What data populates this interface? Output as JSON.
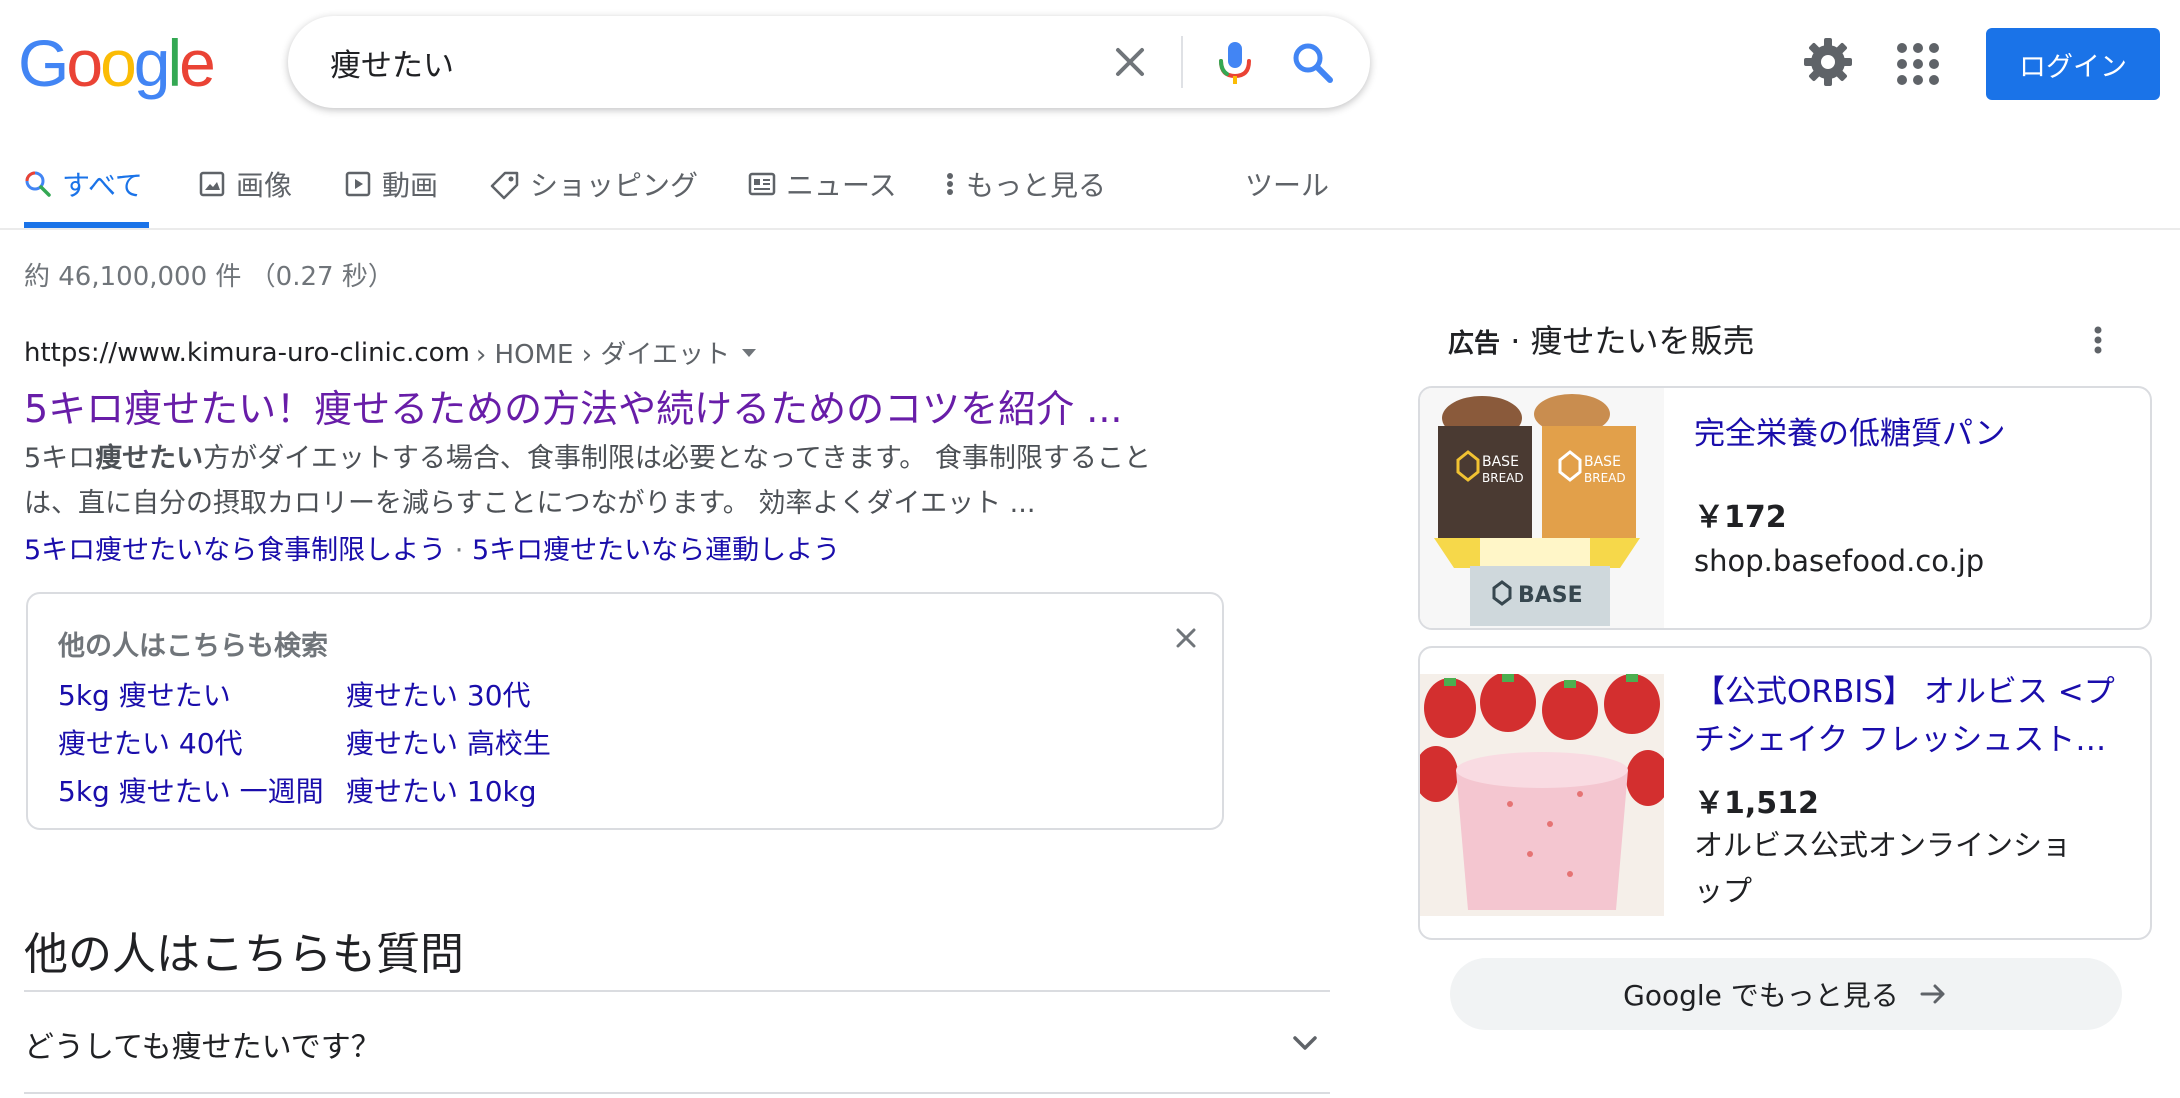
{
  "header": {
    "logo_letters": [
      "G",
      "o",
      "o",
      "g",
      "l",
      "e"
    ],
    "logo_colors": [
      "#4285F4",
      "#EA4335",
      "#FBBC05",
      "#4285F4",
      "#34A853",
      "#EA4335"
    ],
    "query": "痩せたい",
    "login_label": "ログイン"
  },
  "tabs": [
    {
      "label": "すべて",
      "icon": "search-icon",
      "active": true
    },
    {
      "label": "画像",
      "icon": "image-icon"
    },
    {
      "label": "動画",
      "icon": "play-icon"
    },
    {
      "label": "ショッピング",
      "icon": "tag-icon"
    },
    {
      "label": "ニュース",
      "icon": "news-icon"
    },
    {
      "label": "もっと見る",
      "icon": "more-vert-icon"
    },
    {
      "label": "ツール"
    }
  ],
  "stats": "約 46,100,000 件 （0.27 秒）",
  "result": {
    "domain": "https://www.kimura-uro-clinic.com",
    "breadcrumb": " › HOME › ダイエット",
    "title": "5キロ痩せたい！痩せるための方法や続けるためのコツを紹介 ...",
    "snippet_pre": "5キロ",
    "snippet_bold": "痩せたい",
    "snippet_post": "方がダイエットする場合、食事制限は必要となってきます。 食事制限することは、直に自分の摂取カロリーを減らすことにつながります。 効率よくダイエット ...",
    "sitelink1": "5キロ痩せたいなら食事制限しよう",
    "sitelink_sep": " · ",
    "sitelink2": "5キロ痩せたいなら運動しよう"
  },
  "people_also_search": {
    "title": "他の人はこちらも検索",
    "col1": [
      "5kg 痩せたい",
      "痩せたい 40代",
      "5kg 痩せたい 一週間"
    ],
    "col2": [
      "痩せたい 30代",
      "痩せたい 高校生",
      "痩せたい 10kg"
    ]
  },
  "people_also_ask": {
    "title": "他の人はこちらも質問",
    "question": "どうしても痩せたいです？"
  },
  "ads": {
    "ad_label": "広告",
    "heading": " · 痩せたいを販売",
    "items": [
      {
        "title_lines": [
          "完全栄養の低糖質パン"
        ],
        "price": "￥172",
        "store_lines": [
          "shop.basefood.co.jp"
        ],
        "img_text_left": "BASE\nBREAD",
        "img_text_right": "BASE\nBREAD",
        "img_box_text": "BASE"
      },
      {
        "title_lines": [
          "【公式ORBIS】 オルビス <プ",
          "チシェイク フレッシュスト…"
        ],
        "price": "￥1,512",
        "store_lines": [
          "オルビス公式オンラインショ",
          "ップ"
        ]
      }
    ],
    "more_label": "Google でもっと見る"
  }
}
